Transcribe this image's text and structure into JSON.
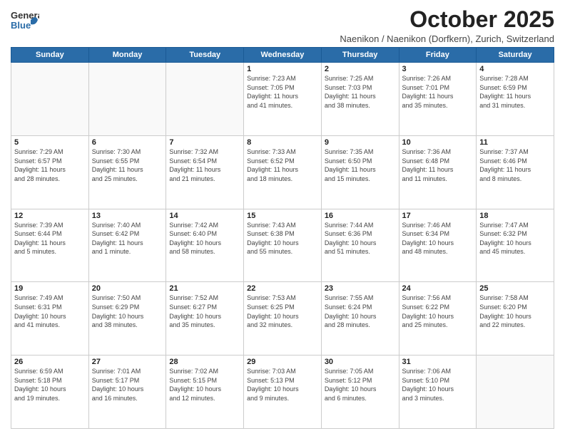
{
  "header": {
    "logo_general": "General",
    "logo_blue": "Blue",
    "month_title": "October 2025",
    "subtitle": "Naenikon / Naenikon (Dorfkern), Zurich, Switzerland"
  },
  "weekdays": [
    "Sunday",
    "Monday",
    "Tuesday",
    "Wednesday",
    "Thursday",
    "Friday",
    "Saturday"
  ],
  "weeks": [
    [
      {
        "day": "",
        "info": ""
      },
      {
        "day": "",
        "info": ""
      },
      {
        "day": "",
        "info": ""
      },
      {
        "day": "1",
        "info": "Sunrise: 7:23 AM\nSunset: 7:05 PM\nDaylight: 11 hours\nand 41 minutes."
      },
      {
        "day": "2",
        "info": "Sunrise: 7:25 AM\nSunset: 7:03 PM\nDaylight: 11 hours\nand 38 minutes."
      },
      {
        "day": "3",
        "info": "Sunrise: 7:26 AM\nSunset: 7:01 PM\nDaylight: 11 hours\nand 35 minutes."
      },
      {
        "day": "4",
        "info": "Sunrise: 7:28 AM\nSunset: 6:59 PM\nDaylight: 11 hours\nand 31 minutes."
      }
    ],
    [
      {
        "day": "5",
        "info": "Sunrise: 7:29 AM\nSunset: 6:57 PM\nDaylight: 11 hours\nand 28 minutes."
      },
      {
        "day": "6",
        "info": "Sunrise: 7:30 AM\nSunset: 6:55 PM\nDaylight: 11 hours\nand 25 minutes."
      },
      {
        "day": "7",
        "info": "Sunrise: 7:32 AM\nSunset: 6:54 PM\nDaylight: 11 hours\nand 21 minutes."
      },
      {
        "day": "8",
        "info": "Sunrise: 7:33 AM\nSunset: 6:52 PM\nDaylight: 11 hours\nand 18 minutes."
      },
      {
        "day": "9",
        "info": "Sunrise: 7:35 AM\nSunset: 6:50 PM\nDaylight: 11 hours\nand 15 minutes."
      },
      {
        "day": "10",
        "info": "Sunrise: 7:36 AM\nSunset: 6:48 PM\nDaylight: 11 hours\nand 11 minutes."
      },
      {
        "day": "11",
        "info": "Sunrise: 7:37 AM\nSunset: 6:46 PM\nDaylight: 11 hours\nand 8 minutes."
      }
    ],
    [
      {
        "day": "12",
        "info": "Sunrise: 7:39 AM\nSunset: 6:44 PM\nDaylight: 11 hours\nand 5 minutes."
      },
      {
        "day": "13",
        "info": "Sunrise: 7:40 AM\nSunset: 6:42 PM\nDaylight: 11 hours\nand 1 minute."
      },
      {
        "day": "14",
        "info": "Sunrise: 7:42 AM\nSunset: 6:40 PM\nDaylight: 10 hours\nand 58 minutes."
      },
      {
        "day": "15",
        "info": "Sunrise: 7:43 AM\nSunset: 6:38 PM\nDaylight: 10 hours\nand 55 minutes."
      },
      {
        "day": "16",
        "info": "Sunrise: 7:44 AM\nSunset: 6:36 PM\nDaylight: 10 hours\nand 51 minutes."
      },
      {
        "day": "17",
        "info": "Sunrise: 7:46 AM\nSunset: 6:34 PM\nDaylight: 10 hours\nand 48 minutes."
      },
      {
        "day": "18",
        "info": "Sunrise: 7:47 AM\nSunset: 6:32 PM\nDaylight: 10 hours\nand 45 minutes."
      }
    ],
    [
      {
        "day": "19",
        "info": "Sunrise: 7:49 AM\nSunset: 6:31 PM\nDaylight: 10 hours\nand 41 minutes."
      },
      {
        "day": "20",
        "info": "Sunrise: 7:50 AM\nSunset: 6:29 PM\nDaylight: 10 hours\nand 38 minutes."
      },
      {
        "day": "21",
        "info": "Sunrise: 7:52 AM\nSunset: 6:27 PM\nDaylight: 10 hours\nand 35 minutes."
      },
      {
        "day": "22",
        "info": "Sunrise: 7:53 AM\nSunset: 6:25 PM\nDaylight: 10 hours\nand 32 minutes."
      },
      {
        "day": "23",
        "info": "Sunrise: 7:55 AM\nSunset: 6:24 PM\nDaylight: 10 hours\nand 28 minutes."
      },
      {
        "day": "24",
        "info": "Sunrise: 7:56 AM\nSunset: 6:22 PM\nDaylight: 10 hours\nand 25 minutes."
      },
      {
        "day": "25",
        "info": "Sunrise: 7:58 AM\nSunset: 6:20 PM\nDaylight: 10 hours\nand 22 minutes."
      }
    ],
    [
      {
        "day": "26",
        "info": "Sunrise: 6:59 AM\nSunset: 5:18 PM\nDaylight: 10 hours\nand 19 minutes."
      },
      {
        "day": "27",
        "info": "Sunrise: 7:01 AM\nSunset: 5:17 PM\nDaylight: 10 hours\nand 16 minutes."
      },
      {
        "day": "28",
        "info": "Sunrise: 7:02 AM\nSunset: 5:15 PM\nDaylight: 10 hours\nand 12 minutes."
      },
      {
        "day": "29",
        "info": "Sunrise: 7:03 AM\nSunset: 5:13 PM\nDaylight: 10 hours\nand 9 minutes."
      },
      {
        "day": "30",
        "info": "Sunrise: 7:05 AM\nSunset: 5:12 PM\nDaylight: 10 hours\nand 6 minutes."
      },
      {
        "day": "31",
        "info": "Sunrise: 7:06 AM\nSunset: 5:10 PM\nDaylight: 10 hours\nand 3 minutes."
      },
      {
        "day": "",
        "info": ""
      }
    ]
  ]
}
